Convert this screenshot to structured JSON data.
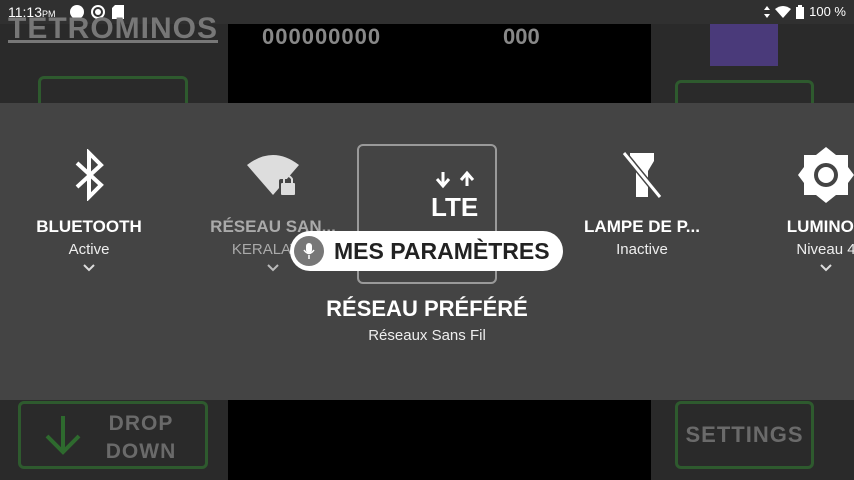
{
  "status_bar": {
    "time": "11:13",
    "ampm": "PM",
    "battery": "100 %",
    "icons": [
      "circle-icon",
      "settings-gear-icon",
      "sd-card-icon",
      "data-arrows-icon",
      "wifi-icon",
      "battery-icon"
    ]
  },
  "game": {
    "title": "TETROMINOS",
    "score": "000000000",
    "lines": "000",
    "drop_button": {
      "line1": "DROP",
      "line2": "DOWN"
    },
    "settings_button": "SETTINGS"
  },
  "quick_settings": {
    "tiles": [
      {
        "title": "BLUETOOTH",
        "subtitle": "Active",
        "icon": "bluetooth-icon"
      },
      {
        "title": "RÉSEAU SAN...",
        "subtitle": "KERALAVIS",
        "icon": "wifi-lock-icon"
      },
      {
        "title": "",
        "subtitle": "",
        "icon": "lte-icon",
        "icon_text": "LTE"
      },
      {
        "title": "LAMPE DE P...",
        "subtitle": "Inactive",
        "icon": "flashlight-off-icon"
      },
      {
        "title": "LUMINOS",
        "subtitle": "Niveau 4",
        "icon": "brightness-icon"
      }
    ],
    "focused_title": "RÉSEAU PRÉFÉRÉ",
    "focused_subtitle": "Réseaux Sans Fil",
    "voice_chip": "MES PARAMÈTRES"
  },
  "colors": {
    "panel": "#444444",
    "status_bar": "#303030",
    "game_button_border": "#2e5a2e",
    "logo": "#4a3a7a"
  }
}
